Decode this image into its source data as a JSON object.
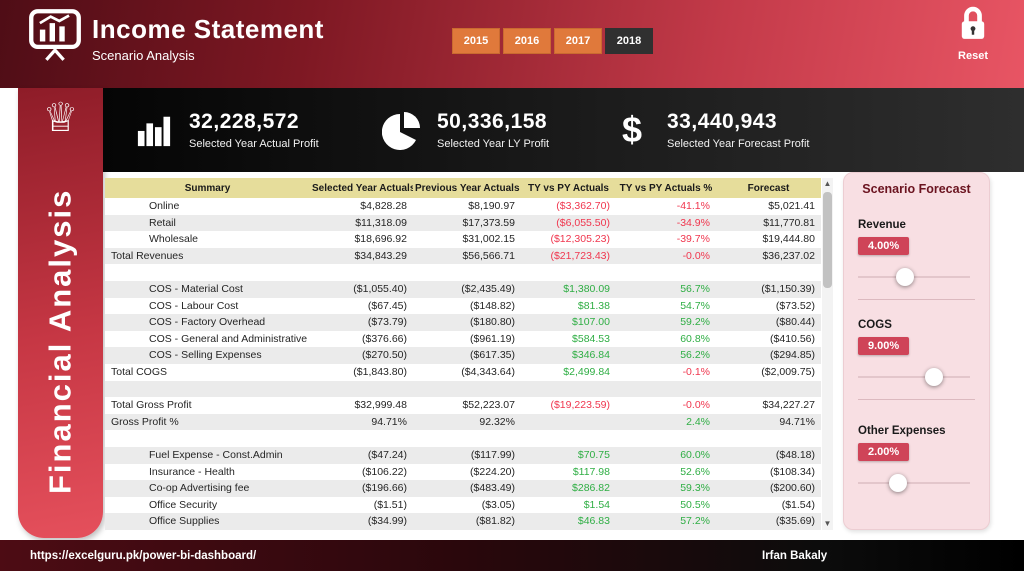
{
  "header": {
    "title": "Income Statement",
    "subtitle": "Scenario Analysis",
    "years": [
      {
        "label": "2015",
        "selected": false
      },
      {
        "label": "2016",
        "selected": false
      },
      {
        "label": "2017",
        "selected": false
      },
      {
        "label": "2018",
        "selected": true
      }
    ],
    "reset_label": "Reset"
  },
  "sidebar": {
    "title": "Financial Analysis"
  },
  "kpis": [
    {
      "icon": "bar-chart-icon",
      "value": "32,228,572",
      "label": "Selected Year Actual Profit"
    },
    {
      "icon": "pie-chart-icon",
      "value": "50,336,158",
      "label": "Selected Year LY Profit"
    },
    {
      "icon": "dollar-icon",
      "value": "33,440,943",
      "label": "Selected Year Forecast Profit"
    }
  ],
  "table": {
    "columns": [
      "Summary",
      "Selected Year Actuals",
      "Previous Year Actuals",
      "TY vs PY Actuals",
      "TY vs PY Actuals %",
      "Forecast"
    ],
    "rows": [
      {
        "name": "Online",
        "indent": true,
        "cells": [
          [
            "$4,828.28",
            ""
          ],
          [
            "$8,190.97",
            ""
          ],
          [
            "($3,362.70)",
            "r"
          ],
          [
            "-41.1%",
            "r"
          ],
          [
            "$5,021.41",
            ""
          ]
        ]
      },
      {
        "name": "Retail",
        "indent": true,
        "cells": [
          [
            "$11,318.09",
            ""
          ],
          [
            "$17,373.59",
            ""
          ],
          [
            "($6,055.50)",
            "r"
          ],
          [
            "-34.9%",
            "r"
          ],
          [
            "$11,770.81",
            ""
          ]
        ]
      },
      {
        "name": "Wholesale",
        "indent": true,
        "cells": [
          [
            "$18,696.92",
            ""
          ],
          [
            "$31,002.15",
            ""
          ],
          [
            "($12,305.23)",
            "r"
          ],
          [
            "-39.7%",
            "r"
          ],
          [
            "$19,444.80",
            ""
          ]
        ]
      },
      {
        "name": "Total Revenues",
        "indent": false,
        "cells": [
          [
            "$34,843.29",
            ""
          ],
          [
            "$56,566.71",
            ""
          ],
          [
            "($21,723.43)",
            "r"
          ],
          [
            "-0.0%",
            "r"
          ],
          [
            "$36,237.02",
            ""
          ]
        ]
      },
      {
        "name": "",
        "blank": true,
        "cells": []
      },
      {
        "name": "COS - Material Cost",
        "indent": true,
        "cells": [
          [
            "($1,055.40)",
            ""
          ],
          [
            "($2,435.49)",
            ""
          ],
          [
            "$1,380.09",
            "g"
          ],
          [
            "56.7%",
            "g"
          ],
          [
            "($1,150.39)",
            ""
          ]
        ]
      },
      {
        "name": "COS - Labour Cost",
        "indent": true,
        "cells": [
          [
            "($67.45)",
            ""
          ],
          [
            "($148.82)",
            ""
          ],
          [
            "$81.38",
            "g"
          ],
          [
            "54.7%",
            "g"
          ],
          [
            "($73.52)",
            ""
          ]
        ]
      },
      {
        "name": "COS - Factory Overhead",
        "indent": true,
        "cells": [
          [
            "($73.79)",
            ""
          ],
          [
            "($180.80)",
            ""
          ],
          [
            "$107.00",
            "g"
          ],
          [
            "59.2%",
            "g"
          ],
          [
            "($80.44)",
            ""
          ]
        ]
      },
      {
        "name": "COS - General and Administrative Ex...",
        "indent": true,
        "cells": [
          [
            "($376.66)",
            ""
          ],
          [
            "($961.19)",
            ""
          ],
          [
            "$584.53",
            "g"
          ],
          [
            "60.8%",
            "g"
          ],
          [
            "($410.56)",
            ""
          ]
        ]
      },
      {
        "name": "COS - Selling Expenses",
        "indent": true,
        "cells": [
          [
            "($270.50)",
            ""
          ],
          [
            "($617.35)",
            ""
          ],
          [
            "$346.84",
            "g"
          ],
          [
            "56.2%",
            "g"
          ],
          [
            "($294.85)",
            ""
          ]
        ]
      },
      {
        "name": "Total COGS",
        "indent": false,
        "cells": [
          [
            "($1,843.80)",
            ""
          ],
          [
            "($4,343.64)",
            ""
          ],
          [
            "$2,499.84",
            "g"
          ],
          [
            "-0.1%",
            "r"
          ],
          [
            "($2,009.75)",
            ""
          ]
        ]
      },
      {
        "name": "",
        "blank": true,
        "cells": []
      },
      {
        "name": "Total Gross Profit",
        "indent": false,
        "cells": [
          [
            "$32,999.48",
            ""
          ],
          [
            "$52,223.07",
            ""
          ],
          [
            "($19,223.59)",
            "r"
          ],
          [
            "-0.0%",
            "r"
          ],
          [
            "$34,227.27",
            ""
          ]
        ]
      },
      {
        "name": "Gross Profit %",
        "indent": false,
        "cells": [
          [
            "94.71%",
            ""
          ],
          [
            "92.32%",
            ""
          ],
          [
            "",
            ""
          ],
          [
            "2.4%",
            "g"
          ],
          [
            "94.71%",
            ""
          ]
        ]
      },
      {
        "name": "",
        "blank": true,
        "cells": []
      },
      {
        "name": "Fuel Expense - Const.Admin",
        "indent": true,
        "cells": [
          [
            "($47.24)",
            ""
          ],
          [
            "($117.99)",
            ""
          ],
          [
            "$70.75",
            "g"
          ],
          [
            "60.0%",
            "g"
          ],
          [
            "($48.18)",
            ""
          ]
        ]
      },
      {
        "name": "Insurance - Health",
        "indent": true,
        "cells": [
          [
            "($106.22)",
            ""
          ],
          [
            "($224.20)",
            ""
          ],
          [
            "$117.98",
            "g"
          ],
          [
            "52.6%",
            "g"
          ],
          [
            "($108.34)",
            ""
          ]
        ]
      },
      {
        "name": "Co-op Advertising fee",
        "indent": true,
        "cells": [
          [
            "($196.66)",
            ""
          ],
          [
            "($483.49)",
            ""
          ],
          [
            "$286.82",
            "g"
          ],
          [
            "59.3%",
            "g"
          ],
          [
            "($200.60)",
            ""
          ]
        ]
      },
      {
        "name": "Office Security",
        "indent": true,
        "cells": [
          [
            "($1.51)",
            ""
          ],
          [
            "($3.05)",
            ""
          ],
          [
            "$1.54",
            "g"
          ],
          [
            "50.5%",
            "g"
          ],
          [
            "($1.54)",
            ""
          ]
        ]
      },
      {
        "name": "Office Supplies",
        "indent": true,
        "cells": [
          [
            "($34.99)",
            ""
          ],
          [
            "($81.82)",
            ""
          ],
          [
            "$46.83",
            "g"
          ],
          [
            "57.2%",
            "g"
          ],
          [
            "($35.69)",
            ""
          ]
        ]
      }
    ]
  },
  "scenario": {
    "title": "Scenario Forecast",
    "sliders": [
      {
        "label": "Revenue",
        "value": "4.00%",
        "knob_pct": 42
      },
      {
        "label": "COGS",
        "value": "9.00%",
        "knob_pct": 68
      },
      {
        "label": "Other Expenses",
        "value": "2.00%",
        "knob_pct": 36
      }
    ]
  },
  "colors": {
    "accent_red": "#cf4458",
    "year_orange": "#e0793b",
    "negative": "#f0364e",
    "positive": "#2fae44",
    "table_header": "#e6dd9b",
    "panel_pink": "#f8dfe3"
  },
  "footer": {
    "url": "https://excelguru.pk/power-bi-dashboard/",
    "author": "Irfan Bakaly"
  }
}
